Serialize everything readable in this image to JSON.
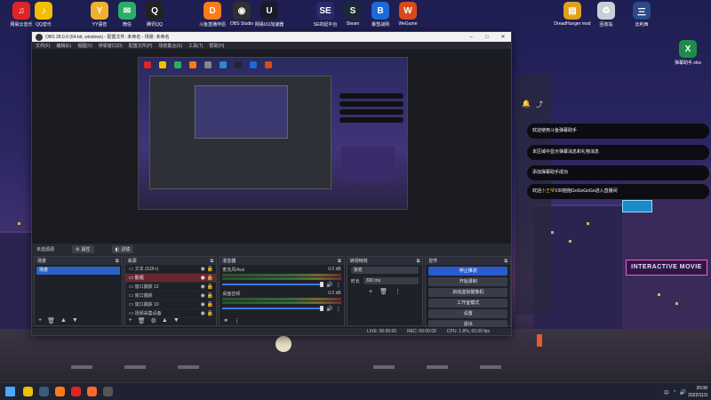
{
  "desktop": {
    "icons": [
      {
        "label": "网易云音乐",
        "icon": "netease-music-icon",
        "color": "#e02424",
        "glyph": "♫"
      },
      {
        "label": "QQ音乐",
        "icon": "qq-music-icon",
        "color": "#f0c000",
        "glyph": "♪"
      },
      {
        "label": "YY语音",
        "icon": "yy-voice-icon",
        "color": "#f0b030",
        "glyph": "Y"
      },
      {
        "label": "微信",
        "icon": "wechat-icon",
        "color": "#2aae67",
        "glyph": "✉"
      },
      {
        "label": "腾讯QQ",
        "icon": "qq-icon",
        "color": "#222222",
        "glyph": "Q"
      },
      {
        "label": "斗鱼直播伴侣",
        "icon": "douyu-icon",
        "color": "#ff7a1a",
        "glyph": "D"
      },
      {
        "label": "OBS Studio",
        "icon": "obs-icon",
        "color": "#302e31",
        "glyph": "◉"
      },
      {
        "label": "网易UU加速器",
        "icon": "uu-booster-icon",
        "color": "#1a1a2a",
        "glyph": "U"
      },
      {
        "label": "SE的起平台",
        "icon": "se-platform-icon",
        "color": "#2a2a6a",
        "glyph": "SE"
      },
      {
        "label": "Steam",
        "icon": "steam-icon",
        "color": "#1b2838",
        "glyph": "S"
      },
      {
        "label": "暴雪战网",
        "icon": "battlenet-icon",
        "color": "#1a6ad8",
        "glyph": "B"
      },
      {
        "label": "WeGame",
        "icon": "wegame-icon",
        "color": "#d84a1a",
        "glyph": "W"
      },
      {
        "label": "DreadHunger mod",
        "icon": "folder-icon",
        "color": "#e0a020",
        "glyph": "▤"
      },
      {
        "label": "回收站",
        "icon": "recycle-bin-icon",
        "color": "#c8d0d8",
        "glyph": "♻"
      },
      {
        "label": "比利西",
        "icon": "game-logo-icon",
        "color": "#2a4a8a",
        "glyph": "三"
      },
      {
        "label": "弹幕助手.xlsx",
        "icon": "excel-file-icon",
        "color": "#1f8a4a",
        "glyph": "X"
      }
    ]
  },
  "obs": {
    "title": "OBS 28.0.0 (64-bit, windows) - 配置文件: 未命名 - 场景: 未命名",
    "menu": [
      "文件(F)",
      "编辑(E)",
      "视图(V)",
      "停靠窗口(D)",
      "配置文件(P)",
      "场景集合(S)",
      "工具(T)",
      "帮助(H)"
    ],
    "scene_label": "未选源源",
    "props_button": "属性",
    "filters_button": "滤镜",
    "docks": {
      "scenes": {
        "title": "场景",
        "items": [
          "场景"
        ]
      },
      "sources": {
        "title": "来源",
        "items": [
          "文本 (GDI+)",
          "影视",
          "窗口捕获 12",
          "窗口捕获",
          "窗口捕获 10",
          "视频采集设备"
        ]
      },
      "mixer": {
        "title": "混音器",
        "tracks": [
          {
            "name": "麦克风/Aux",
            "db": "0.0 dB"
          },
          {
            "name": "桌面音频",
            "db": "0.0 dB"
          }
        ]
      },
      "transitions": {
        "title": "转场特效",
        "type": "渐变",
        "duration_label": "时长",
        "duration": "300 ms"
      },
      "controls": {
        "title": "控件",
        "buttons": [
          "停止推流",
          "开始录制",
          "启动虚拟摄像机",
          "工作室模式",
          "设置",
          "退出"
        ]
      }
    },
    "status": {
      "live": "LIVE: 00:00:00",
      "rec": "REC: 00:00:00",
      "cpu": "CPU: 1.8%, 60.00 fps"
    }
  },
  "chat": {
    "messages": [
      {
        "text": "欢迎使用斗鱼弹幕助手",
        "highlight": ""
      },
      {
        "text": "本区域中显示弹幕消息和礼物消息",
        "highlight": ""
      },
      {
        "text": "添加弹幕助手成功",
        "highlight": ""
      },
      {
        "text": "欢迎",
        "highlight": "小王爷",
        "rest": "V30抱抱GoGoGoGo进入直播间"
      }
    ]
  },
  "overlay": {
    "sign_text": "INTERACTIVE MOVIE"
  },
  "taskbar": {
    "apps": [
      {
        "icon": "windows-start-icon",
        "color": "#4aa8ff"
      },
      {
        "icon": "qq-music-icon",
        "color": "#f0c000"
      },
      {
        "icon": "steam-icon",
        "color": "#3a5a80"
      },
      {
        "icon": "douyu-icon",
        "color": "#ff7a1a"
      },
      {
        "icon": "netease-music-icon",
        "color": "#e02424"
      },
      {
        "icon": "douyu-assist-icon",
        "color": "#ff6a2a"
      },
      {
        "icon": "obs-icon",
        "color": "#555555"
      }
    ],
    "tray_ime": "中",
    "clock_time": "20:08",
    "clock_date": "2022/11/3"
  }
}
